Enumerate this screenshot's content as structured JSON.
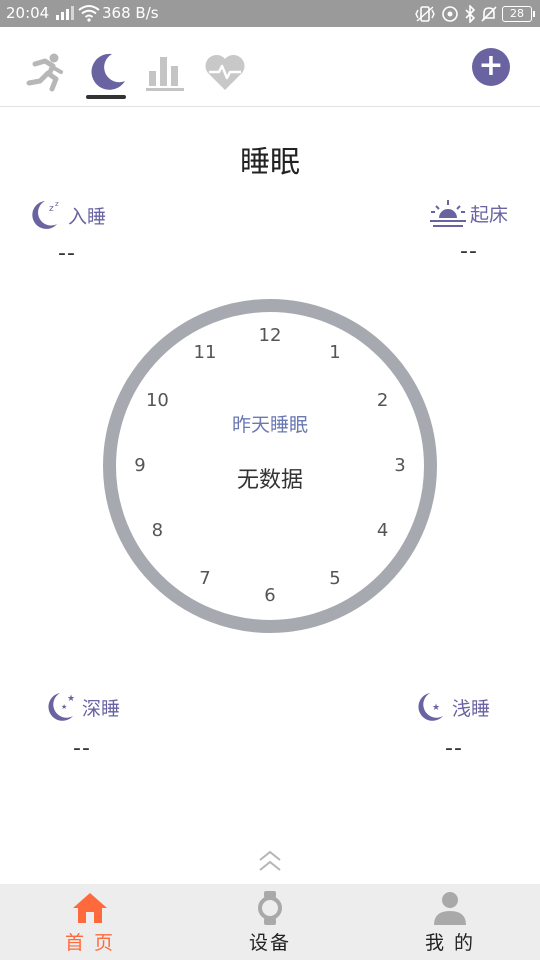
{
  "status_bar": {
    "time": "20:04",
    "speed": "368 B/s",
    "battery": "28"
  },
  "top_tabs": [
    {
      "name": "activity",
      "icon": "running-person-icon"
    },
    {
      "name": "sleep",
      "icon": "moon-icon",
      "active": true
    },
    {
      "name": "stats",
      "icon": "bar-chart-icon"
    },
    {
      "name": "heart",
      "icon": "heart-rate-icon"
    }
  ],
  "add_button": "+",
  "page_title": "睡眠",
  "fall_asleep": {
    "label": "入睡",
    "value": "--"
  },
  "wake_up": {
    "label": "起床",
    "value": "--"
  },
  "clock": {
    "numbers": [
      "12",
      "1",
      "2",
      "3",
      "4",
      "5",
      "6",
      "7",
      "8",
      "9",
      "10",
      "11"
    ],
    "subtitle": "昨天睡眠",
    "status": "无数据"
  },
  "deep_sleep": {
    "label": "深睡",
    "value": "--"
  },
  "light_sleep": {
    "label": "浅睡",
    "value": "--"
  },
  "bottom_nav": {
    "home": "首 页",
    "device": "设备",
    "me": "我 的"
  },
  "colors": {
    "accent": "#6a63a2",
    "active_nav": "#ff6a3d",
    "clock_ring": "#a7a9b1"
  }
}
